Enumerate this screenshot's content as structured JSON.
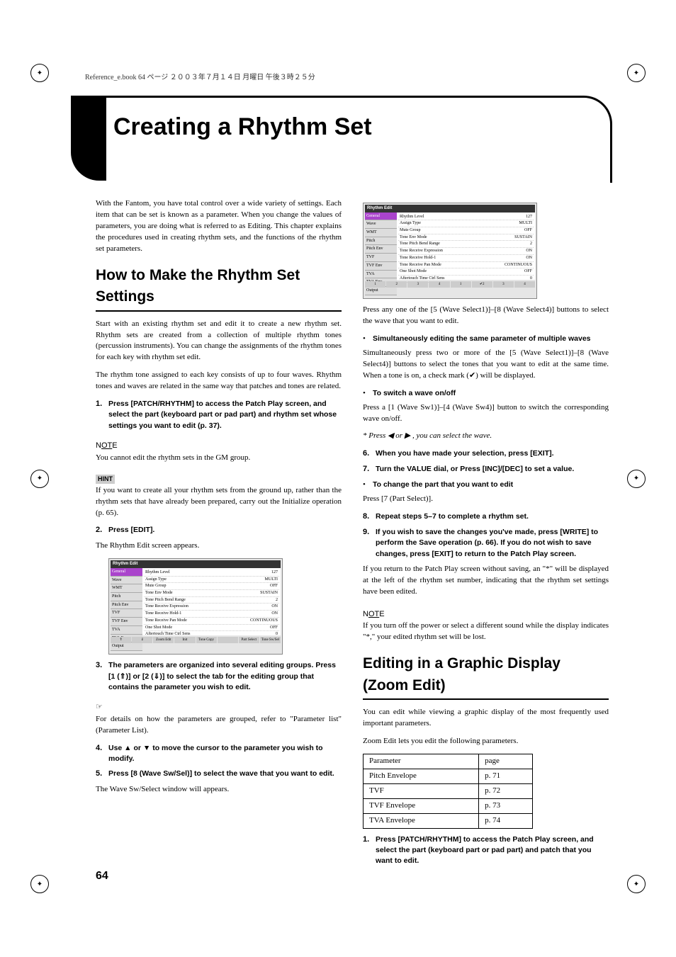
{
  "header_line": "Reference_e.book 64 ページ ２００３年７月１４日 月曜日 午後３時２５分",
  "title": "Creating a Rhythm Set",
  "page_number": "64",
  "intro": "With the Fantom, you have total control over a wide variety of settings. Each item that can be set is known as a parameter. When you change the values of parameters, you are doing what is referred to as Editing. This chapter explains the procedures used in creating rhythm sets, and the functions of the rhythm set parameters.",
  "h2_1": "How to Make the Rhythm Set Settings",
  "para1": "Start with an existing rhythm set and edit it to create a new rhythm set. Rhythm sets are created from a collection of multiple rhythm tones (percussion instruments). You can change the assignments of the rhythm tones for each key with rhythm set edit.",
  "para2": "The rhythm tone assigned to each key consists of up to four waves. Rhythm tones and waves are related in the same way that patches and tones are related.",
  "step1": "Press [PATCH/RHYTHM] to access the Patch Play screen, and select the part (keyboard part or pad part) and rhythm set whose settings you want to edit (p. 37).",
  "note1": "You cannot edit the rhythm sets in the GM group.",
  "hint1": "If you want to create all your rhythm sets from the ground up, rather than the rhythm sets that have already been prepared, carry out the Initialize operation (p. 65).",
  "step2": "Press [EDIT].",
  "step2_after": "The Rhythm Edit screen appears.",
  "step3": "The parameters are organized into several editing groups. Press [1 (⇑)] or [2 (⇓)] to select the tab for the editing group that contains the parameter you wish to edit.",
  "ref1": "For details on how the parameters are grouped, refer to \"Parameter list\" (Parameter List).",
  "step4": "Use  ▲  or  ▼  to move the cursor to the parameter you wish to modify.",
  "step5": "Press [8 (Wave Sw/Sel)] to select the wave that you want to edit.",
  "step5_after": "The Wave Sw/Select window will appears.",
  "col2_p1": "Press any one of the [5 (Wave Select1)]–[8 (Wave Select4)] buttons to select the wave that you want to edit.",
  "bullet_sim_title": "Simultaneously editing the same parameter of multiple waves",
  "bullet_sim_body": "Simultaneously press two or more of the [5 (Wave Select1)]–[8 (Wave Select4)] buttons to select the tones that you want to edit at the same time. When a tone is on, a check mark (✔) will be displayed.",
  "bullet_sw_title": "To switch a wave on/off",
  "bullet_sw_body": "Press a [1 (Wave Sw1)]–[4 (Wave Sw4)] button to switch the corresponding wave on/off.",
  "star_note": "Press  ◀  or  ▶ , you can select the wave.",
  "step6": "When you have made your selection, press [EXIT].",
  "step7": "Turn the VALUE dial, or Press [INC]/[DEC] to set a value.",
  "step7_sub_t": "To change the part that you want to edit",
  "step7_sub_b": "Press [7 (Part Select)].",
  "step8": "Repeat steps 5–7 to complete a rhythm set.",
  "step9": "If you wish to save the changes you've made, press [WRITE] to perform the Save operation (p. 66). If you do not wish to save changes, press [EXIT] to return to the Patch Play screen.",
  "step9_after": "If you return to the Patch Play screen without saving, an \"*\" will be displayed at the left of the rhythm set number, indicating that the rhythm set settings have been edited.",
  "note2": "If you turn off the power or select a different sound while the display indicates \"*,\" your edited rhythm set will be lost.",
  "h2_2": "Editing in a Graphic Display (Zoom Edit)",
  "zoom_p1": "You can edit while viewing a graphic display of the most frequently used important parameters.",
  "zoom_p2": "Zoom Edit lets you edit the following parameters.",
  "table": {
    "headers": [
      "Parameter",
      "page"
    ],
    "rows": [
      [
        "Pitch Envelope",
        "p. 71"
      ],
      [
        "TVF",
        "p. 72"
      ],
      [
        "TVF Envelope",
        "p. 73"
      ],
      [
        "TVA Envelope",
        "p. 74"
      ]
    ]
  },
  "zoom_step1": "Press [PATCH/RHYTHM] to access the Patch Play screen, and select the part (keyboard part or pad part) and patch that you want to edit.",
  "sc": {
    "title": "Rhythm Edit",
    "nav": [
      "General",
      "Wave",
      "WMT",
      "Pitch",
      "Pitch Env",
      "TVF",
      "TVF Env",
      "TVA",
      "TVA Env",
      "Output"
    ],
    "rows": [
      [
        "Rhythm Level",
        "127"
      ],
      [
        "Assign Type",
        "MULTI"
      ],
      [
        "Mute Group",
        "OFF"
      ],
      [
        "Tone Env Mode",
        "SUSTAIN"
      ],
      [
        "Tone Pitch Bend Range",
        "2"
      ],
      [
        "Tone Receive Expression",
        "ON"
      ],
      [
        "Tone Receive Hold-1",
        "ON"
      ],
      [
        "Tone Receive Pan Mode",
        "CONTINUOUS"
      ],
      [
        "One Shot Mode",
        "OFF"
      ],
      [
        "Aftertouch Time Ctrl Sens",
        "0"
      ]
    ],
    "foot": [
      "⇑",
      "⇓",
      "Zoom Edit",
      "Init",
      "Tone Copy",
      "",
      "Part Select",
      "Tone Sw/Sel"
    ]
  }
}
